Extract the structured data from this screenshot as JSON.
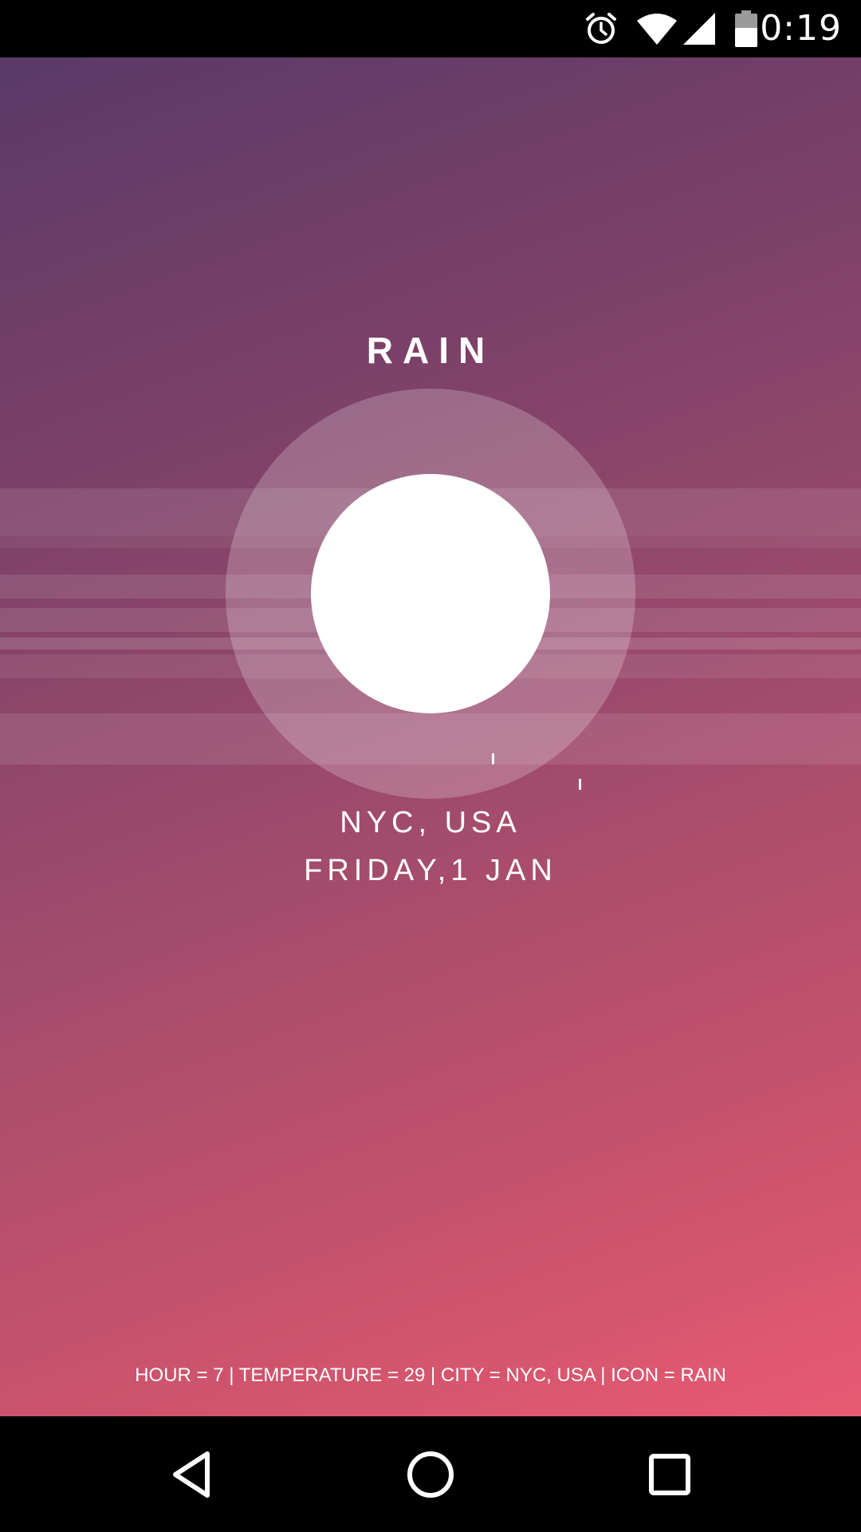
{
  "status_bar": {
    "time": "0:19",
    "icons": [
      "alarm-icon",
      "wifi-icon",
      "cellular-signal-icon",
      "battery-icon"
    ]
  },
  "weather": {
    "condition": "RAIN",
    "city": "NYC, USA",
    "date": "FRIDAY,1 JAN",
    "debug": "HOUR = 7 | TEMPERATURE = 29 | CITY = NYC, USA | ICON = RAIN"
  },
  "nav_bar": {
    "buttons": [
      "back-icon",
      "home-icon",
      "recents-icon"
    ]
  },
  "colors": {
    "gradient_top": "#5a3a68",
    "gradient_bottom": "#e85a72",
    "text": "#ffffff"
  }
}
